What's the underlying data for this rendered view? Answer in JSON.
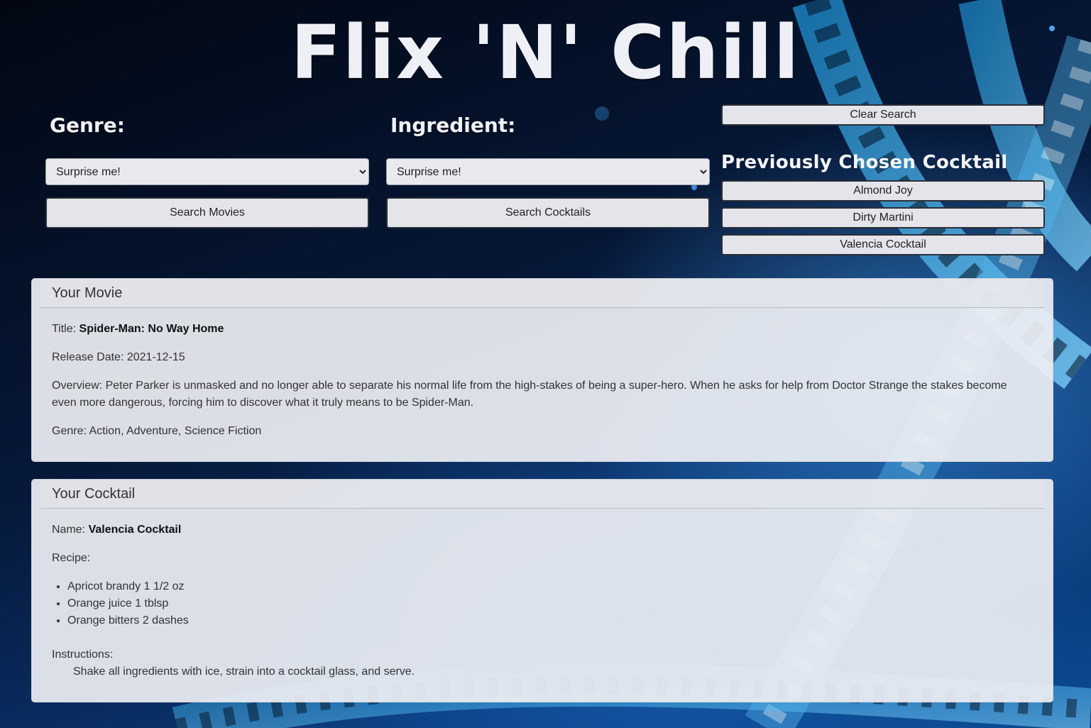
{
  "app": {
    "title": "Flix 'N' Chill"
  },
  "genre": {
    "label": "Genre:",
    "selected": "Surprise me!",
    "search_label": "Search Movies"
  },
  "ingredient": {
    "label": "Ingredient:",
    "selected": "Surprise me!",
    "search_label": "Search Cocktails"
  },
  "history": {
    "clear_label": "Clear Search",
    "title": "Previously Chosen Cocktail",
    "items": [
      {
        "label": "Almond Joy"
      },
      {
        "label": "Dirty Martini"
      },
      {
        "label": "Valencia Cocktail"
      }
    ]
  },
  "movie": {
    "heading": "Your Movie",
    "title_label": "Title:",
    "title": "Spider-Man: No Way Home",
    "release_label": "Release Date:",
    "release_date": "2021-12-15",
    "overview_label": "Overview:",
    "overview": "Peter Parker is unmasked and no longer able to separate his normal life from the high-stakes of being a super-hero. When he asks for help from Doctor Strange the stakes become even more dangerous, forcing him to discover what it truly means to be Spider-Man.",
    "genre_label": "Genre:",
    "genres": "Action, Adventure, Science Fiction"
  },
  "cocktail": {
    "heading": "Your Cocktail",
    "name_label": "Name:",
    "name": "Valencia Cocktail",
    "recipe_label": "Recipe:",
    "ingredients": [
      "Apricot brandy 1 1/2 oz",
      "Orange juice 1 tblsp",
      "Orange bitters 2 dashes"
    ],
    "instructions_label": "Instructions:",
    "instructions": "Shake all ingredients with ice, strain into a cocktail glass, and serve."
  }
}
